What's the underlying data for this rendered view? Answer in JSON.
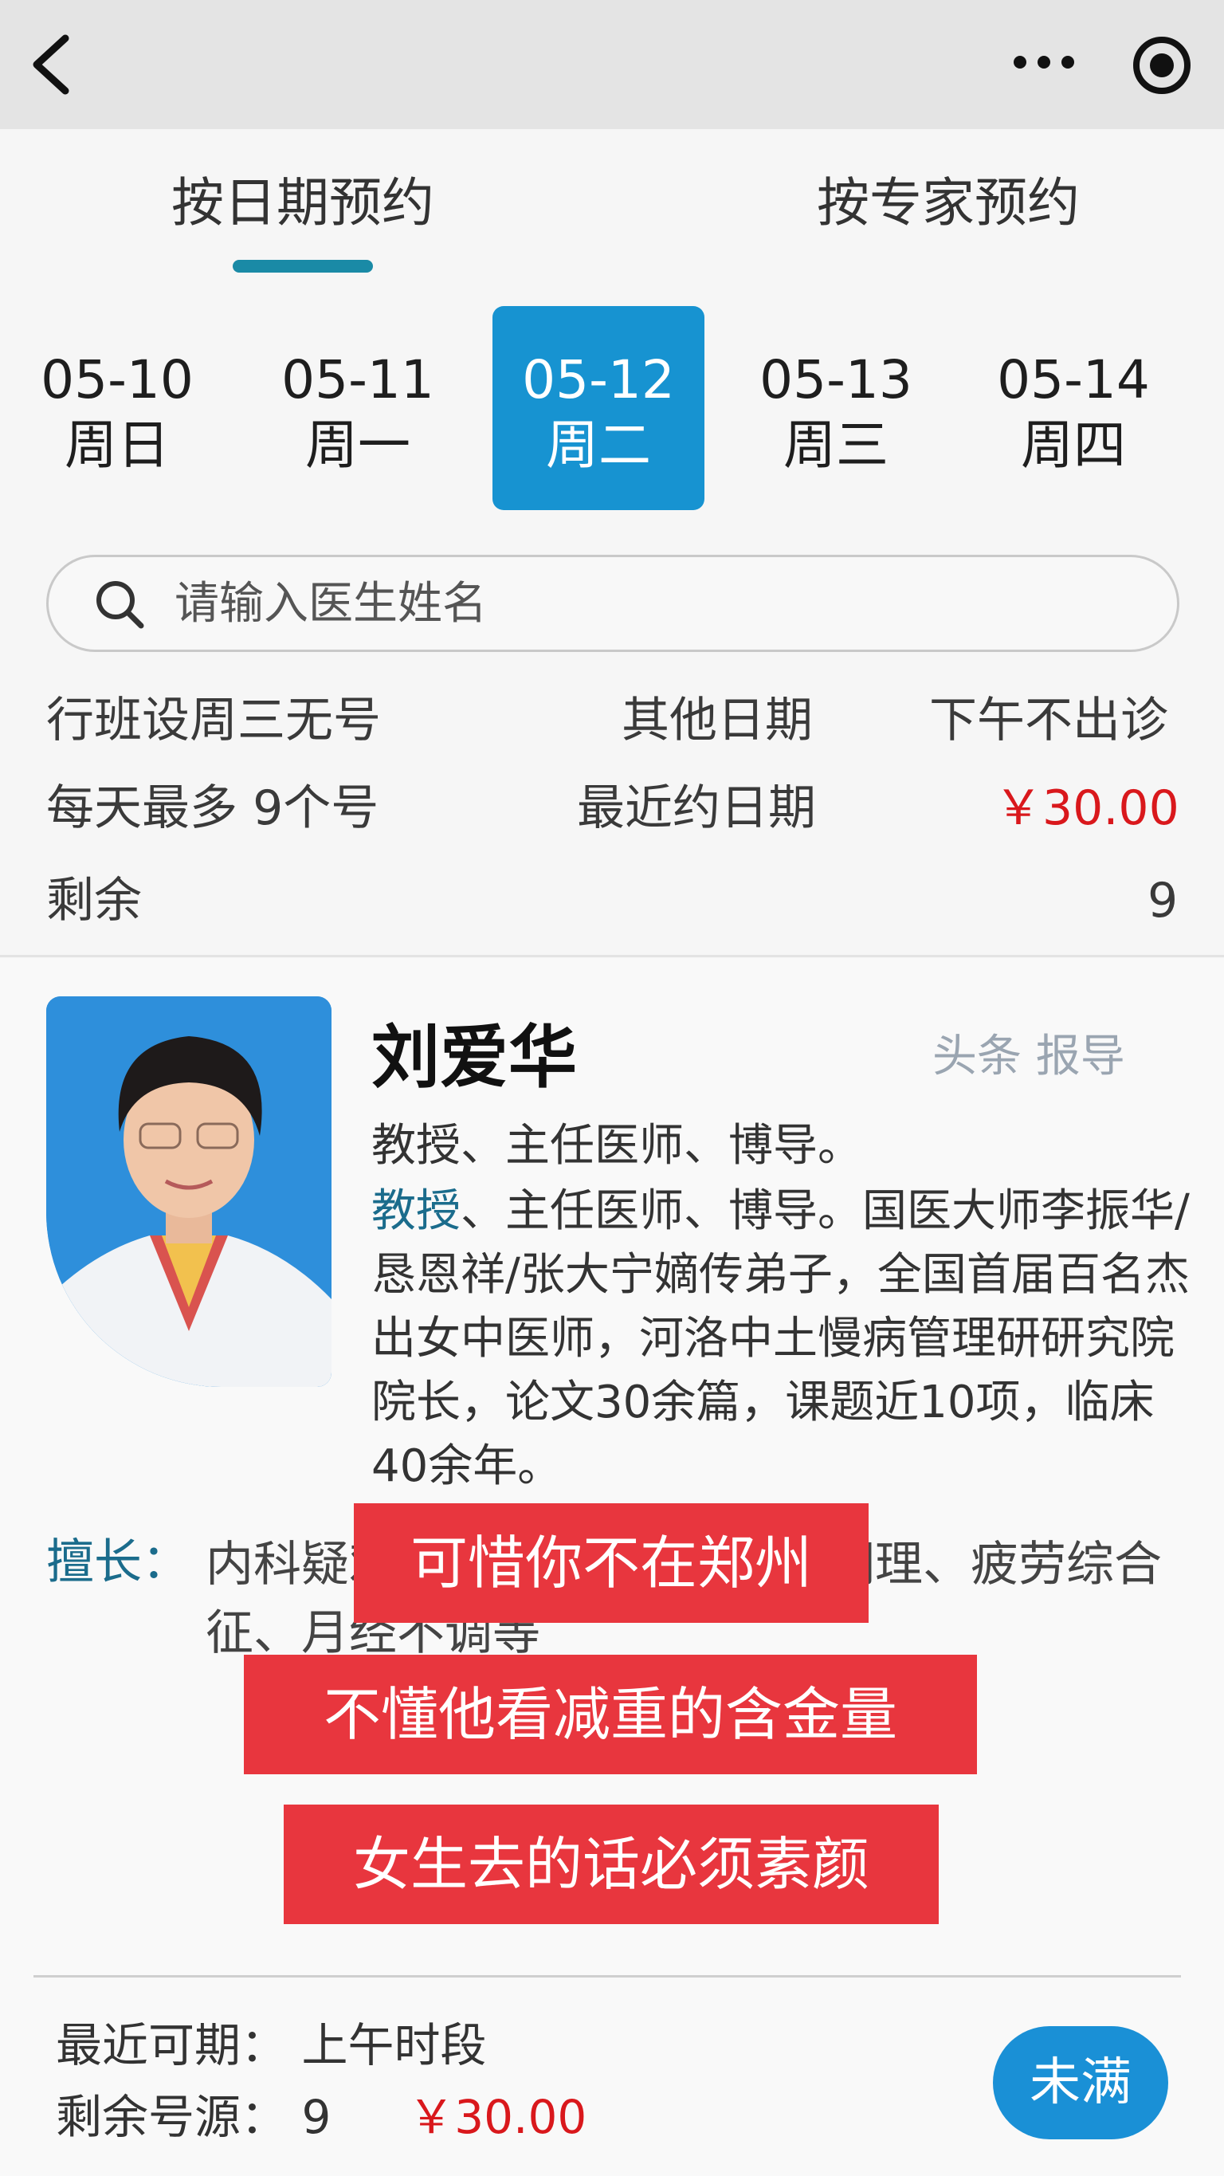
{
  "tabs": {
    "by_date": "按日期预约",
    "by_expert": "按专家预约"
  },
  "dates": [
    {
      "date": "05-10",
      "weekday": "周日"
    },
    {
      "date": "05-11",
      "weekday": "周一"
    },
    {
      "date": "05-12",
      "weekday": "周二",
      "selected": true
    },
    {
      "date": "05-13",
      "weekday": "周三"
    },
    {
      "date": "05-14",
      "weekday": "周四"
    }
  ],
  "search": {
    "placeholder": "请输入医生姓名"
  },
  "info": {
    "row1_left": "行班设周三无号",
    "row1_mid": "其他日期",
    "row1_right": "下午不出诊",
    "row2_left": "每天最多 9个号",
    "row2_mid": "最近约日期",
    "row2_price": "￥30.00",
    "row3_left": "剩余",
    "row3_right": "9"
  },
  "doctor": {
    "name": "刘爱华",
    "watermark": "头条 报导",
    "title": "教授、主任医师、博导。",
    "desc_highlight": "教授",
    "desc_rest": "、主任医师、博导。国医大师李振华/恳恩祥/张大宁嫡传弟子，全国首届百名杰出女中医师，河洛中土慢病管理研研究院院长，论文30余篇，课题近10项，临床40余年。",
    "skill_label": "擅长：",
    "skill_text": "内科疑难杂症、脾胃病、慢病调理、疲劳综合征、月经不调等"
  },
  "captions": [
    "可惜你不在郑州",
    "不懂他看减重的含金量",
    "女生去的话必须素颜"
  ],
  "bottom": {
    "recent_label": "最近可期：",
    "recent_value": "上午时段",
    "remaining_label": "剩余号源：",
    "remaining_value": "9",
    "price": "￥30.00",
    "status": "未满"
  },
  "colors": {
    "accent": "#1793d1",
    "tab_underline": "#1a8aa6",
    "price": "#d9181c",
    "caption_bg": "#e8363e"
  }
}
